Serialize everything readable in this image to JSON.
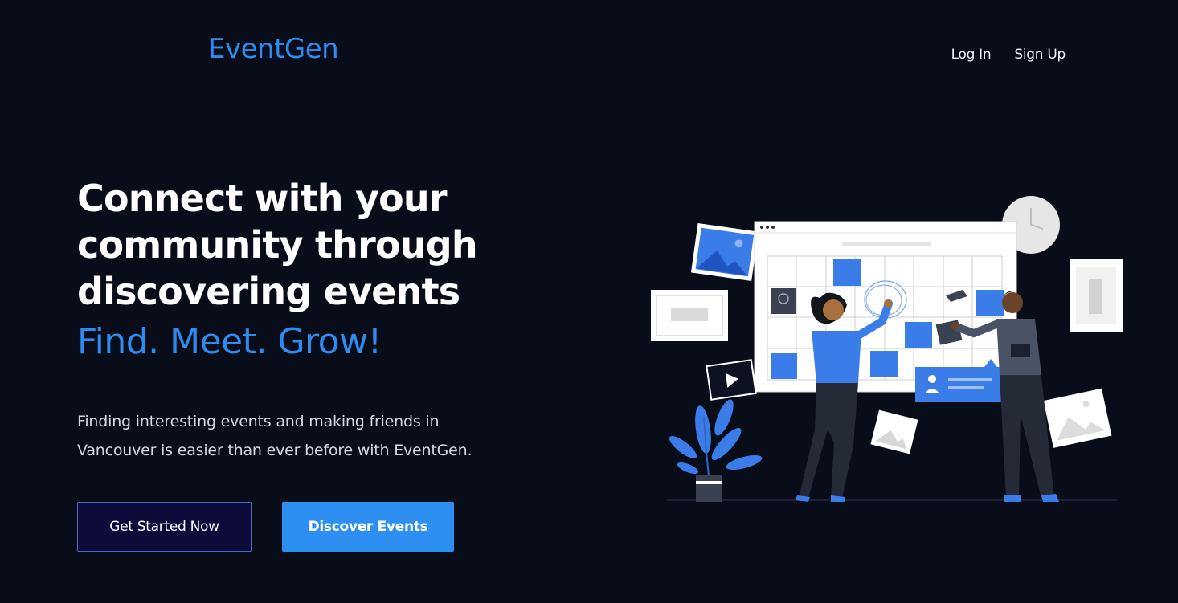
{
  "brand": {
    "logo_text": "EventGen",
    "accent_color": "#2e8cf0"
  },
  "nav": {
    "login_label": "Log In",
    "signup_label": "Sign Up"
  },
  "hero": {
    "headline_lines": [
      "Connect with your",
      "community through",
      "discovering events"
    ],
    "tagline": "Find. Meet. Grow!",
    "description_lines": [
      "Finding interesting events and making friends in",
      "Vancouver is easier than ever before with EventGen."
    ],
    "primary_cta": "Get Started Now",
    "secondary_cta": "Discover Events"
  },
  "illustration": {
    "icon": "calendar-planning-illustration"
  }
}
